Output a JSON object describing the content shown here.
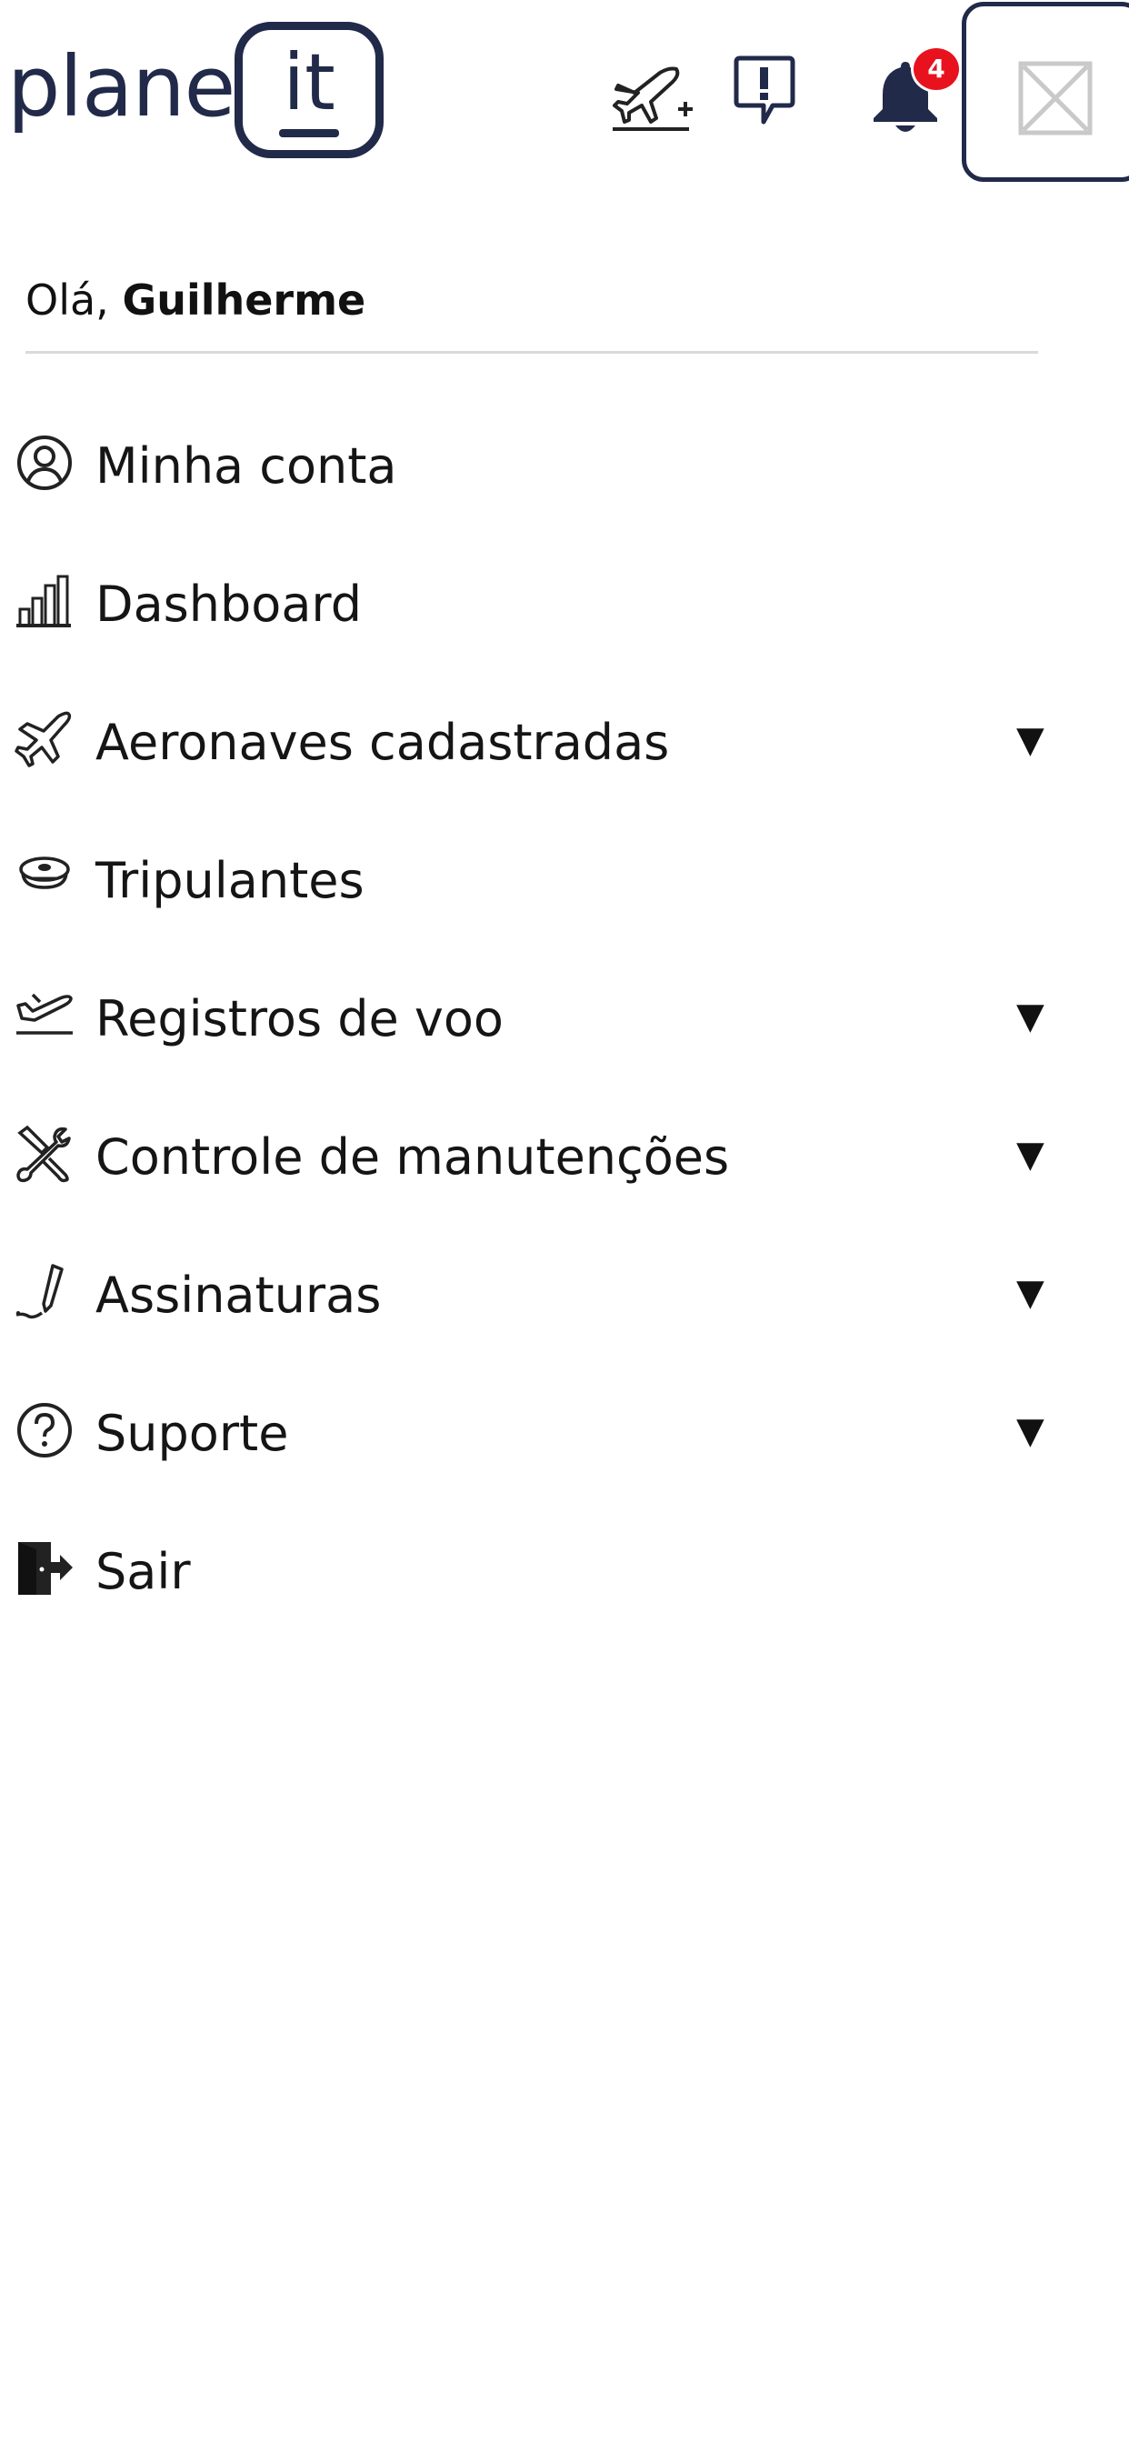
{
  "header": {
    "logo_text": "plane",
    "logo_box_text": "it",
    "notification_count": "4",
    "colors": {
      "brand": "#222a4a",
      "badge": "#e8121e"
    },
    "icons": [
      "plane-add-icon",
      "alert-speech-icon",
      "bell-icon",
      "close-icon"
    ]
  },
  "greeting": {
    "prefix": "Olá,",
    "name": "Guilherme"
  },
  "menu": {
    "items": [
      {
        "label": "Minha conta",
        "icon": "user-circle-icon",
        "has_submenu": false
      },
      {
        "label": "Dashboard",
        "icon": "bar-chart-icon",
        "has_submenu": false
      },
      {
        "label": "Aeronaves cadastradas",
        "icon": "airplane-icon",
        "has_submenu": true
      },
      {
        "label": "Tripulantes",
        "icon": "pilot-cap-icon",
        "has_submenu": false
      },
      {
        "label": "Registros de voo",
        "icon": "takeoff-icon",
        "has_submenu": true
      },
      {
        "label": "Controle de manutenções",
        "icon": "tools-icon",
        "has_submenu": true
      },
      {
        "label": "Assinaturas",
        "icon": "pen-signature-icon",
        "has_submenu": true
      },
      {
        "label": "Suporte",
        "icon": "help-circle-icon",
        "has_submenu": true
      },
      {
        "label": "Sair",
        "icon": "logout-icon",
        "has_submenu": false
      }
    ],
    "caret": "▼"
  }
}
